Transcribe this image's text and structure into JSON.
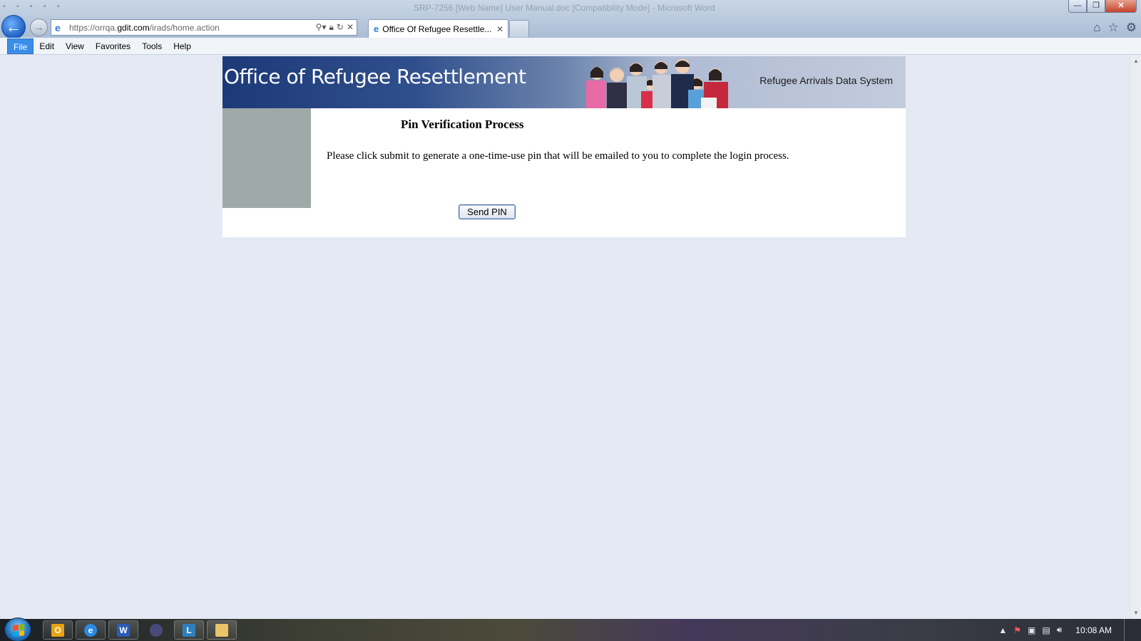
{
  "window": {
    "title": "SRP-7256 [Web Name] User Manual.doc [Compatibility Mode] - Microsoft Word",
    "controls": {
      "minimize": "—",
      "restore": "❐",
      "close": "✕"
    }
  },
  "browser": {
    "url_prefix": "https://orrqa.",
    "url_domain": "gdit.com",
    "url_path": "/irads/home.action",
    "tab_label": "Office Of Refugee Resettle...",
    "tab_close": "✕",
    "icons": [
      "back-arrow-icon",
      "forward-arrow-icon",
      "ie-logo-icon",
      "search-icon",
      "lock-icon",
      "refresh-icon",
      "stop-icon",
      "home-icon",
      "favorites-star-icon",
      "settings-gear-icon"
    ]
  },
  "menubar": {
    "items": [
      "File",
      "Edit",
      "View",
      "Favorites",
      "Tools",
      "Help"
    ]
  },
  "page": {
    "org_title": "Office of Refugee Resettlement",
    "system_title": "Refugee Arrivals Data System",
    "heading": "Pin Verification Process",
    "instructions": "Please click submit to generate a one-time-use pin that will be emailed to you to complete the login process.",
    "send_pin_label": "Send PIN"
  },
  "taskbar": {
    "apps": [
      {
        "name": "outlook",
        "glyph": "O",
        "color": "#e8a310"
      },
      {
        "name": "internet-explorer",
        "glyph": "e",
        "color": "#2b8ae0"
      },
      {
        "name": "word",
        "glyph": "W",
        "color": "#2a5bb5"
      },
      {
        "name": "app-4",
        "glyph": "",
        "color": "#4a4a7a"
      },
      {
        "name": "lync",
        "glyph": "L",
        "color": "#2f7fbf"
      },
      {
        "name": "file-explorer",
        "glyph": "",
        "color": "#e9c46a"
      }
    ],
    "clock": "10:08 AM"
  }
}
